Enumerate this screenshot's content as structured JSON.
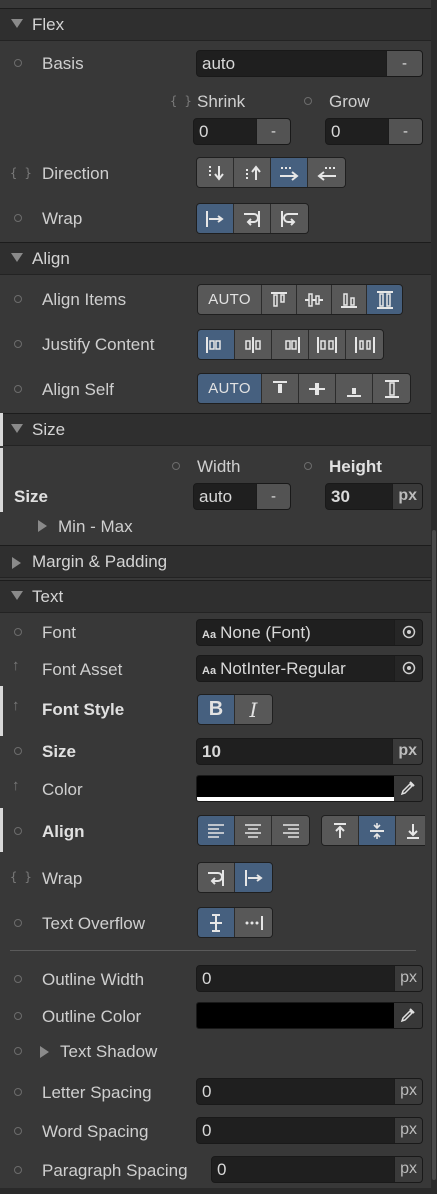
{
  "sections": {
    "flex": "Flex",
    "align": "Align",
    "size": "Size",
    "margin_padding": "Margin & Padding",
    "text": "Text"
  },
  "flex": {
    "basis_label": "Basis",
    "basis_value": "auto",
    "basis_btn": "-",
    "shrink_label": "Shrink",
    "shrink_value": "0",
    "shrink_btn": "-",
    "grow_label": "Grow",
    "grow_value": "0",
    "grow_btn": "-",
    "direction_label": "Direction",
    "direction_options": [
      "column",
      "column-reverse",
      "row",
      "row-reverse"
    ],
    "direction_selected": "row",
    "wrap_label": "Wrap",
    "wrap_options": [
      "nowrap",
      "wrap",
      "wrap-reverse"
    ],
    "wrap_selected": "nowrap"
  },
  "align": {
    "align_items_label": "Align Items",
    "align_items_auto": "AUTO",
    "align_items_selected": "stretch",
    "justify_label": "Justify Content",
    "justify_selected": "flex-start",
    "align_self_label": "Align Self",
    "align_self_auto": "AUTO",
    "align_self_selected": "auto"
  },
  "size": {
    "row_label": "Size",
    "width_label": "Width",
    "width_value": "auto",
    "width_btn": "-",
    "height_label": "Height",
    "height_value": "30",
    "height_unit": "px",
    "minmax_label": "Min - Max"
  },
  "text": {
    "font_label": "Font",
    "font_prefix": "Aa",
    "font_value": "None (Font)",
    "font_asset_label": "Font Asset",
    "font_asset_prefix": "Aa",
    "font_asset_value": "NotInter-Regular",
    "font_style_label": "Font Style",
    "bold_glyph": "B",
    "italic_glyph": "I",
    "size_label": "Size",
    "size_value": "10",
    "size_unit": "px",
    "color_label": "Color",
    "color_value": "#000000",
    "align_label": "Align",
    "align_horizontal_selected": "left",
    "align_vertical_selected": "middle",
    "wrap_label": "Wrap",
    "wrap_selected": "nowrap",
    "overflow_label": "Text Overflow",
    "overflow_selected": "clip",
    "outline_width_label": "Outline Width",
    "outline_width_value": "0",
    "outline_width_unit": "px",
    "outline_color_label": "Outline Color",
    "outline_color_value": "#000000",
    "shadow_label": "Text Shadow",
    "letter_spacing_label": "Letter Spacing",
    "letter_spacing_value": "0",
    "letter_spacing_unit": "px",
    "word_spacing_label": "Word Spacing",
    "word_spacing_value": "0",
    "word_spacing_unit": "px",
    "paragraph_spacing_label": "Paragraph Spacing",
    "paragraph_spacing_value": "0",
    "paragraph_spacing_unit": "px"
  },
  "colors": {
    "panel_bg": "#383838",
    "section_bg": "#2f2f2f",
    "field_bg": "#1f1f1f",
    "button_bg": "#585858",
    "selected_bg": "#46607f"
  }
}
